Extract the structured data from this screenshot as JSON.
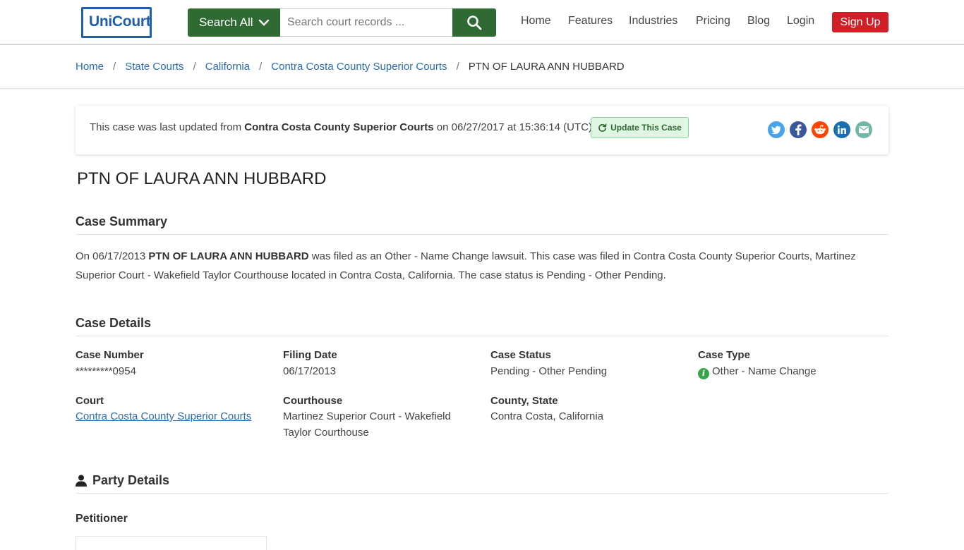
{
  "header": {
    "logo_text": "UniCourt",
    "search_scope": "Search All",
    "search_placeholder": "Search court records ...",
    "search_value": "",
    "nav": [
      "Home",
      "Features",
      "Industries",
      "Pricing",
      "Blog",
      "Login"
    ],
    "signup": "Sign Up",
    "colors": {
      "brand_green": "#2e6a31",
      "brand_blue": "#1d5fa8",
      "signup_red": "#d11f28"
    }
  },
  "breadcrumb": {
    "items": [
      "Home",
      "State Courts",
      "California",
      "Contra Costa County Superior Courts"
    ],
    "separator": "/",
    "current": "PTN OF LAURA ANN HUBBARD"
  },
  "update": {
    "prefix": "This case was last updated from ",
    "court": "Contra Costa County Superior Courts",
    "suffix": " on 06/27/2017 at 15:36:14 (UTC).",
    "button": "Update This Case",
    "share_icons": [
      "twitter-icon",
      "facebook-icon",
      "reddit-icon",
      "linkedin-icon",
      "email-icon"
    ]
  },
  "case": {
    "title": "PTN OF LAURA ANN HUBBARD",
    "summary_heading": "Case Summary",
    "summary_pre": "On 06/17/2013 ",
    "summary_name": "PTN OF LAURA ANN HUBBARD",
    "summary_post": " was filed as an Other - Name Change lawsuit. This case was filed in Contra Costa County Superior Courts, Martinez Superior Court - Wakefield Taylor Courthouse located in Contra Costa, California. The case status is Pending - Other Pending.",
    "details_heading": "Case Details",
    "fields": {
      "case_number_label": "Case Number",
      "case_number": "*********0954",
      "filing_date_label": "Filing Date",
      "filing_date": "06/17/2013",
      "status_label": "Case Status",
      "status": "Pending - Other Pending",
      "type_label": "Case Type",
      "type": "Other - Name Change",
      "court_label": "Court",
      "court": "Contra Costa County Superior Courts",
      "courthouse_label": "Courthouse",
      "courthouse": "Martinez Superior Court - Wakefield Taylor Courthouse",
      "county_label": "County, State",
      "county": "Contra Costa, California"
    },
    "party_heading": "Party Details",
    "petitioner_heading": "Petitioner"
  }
}
